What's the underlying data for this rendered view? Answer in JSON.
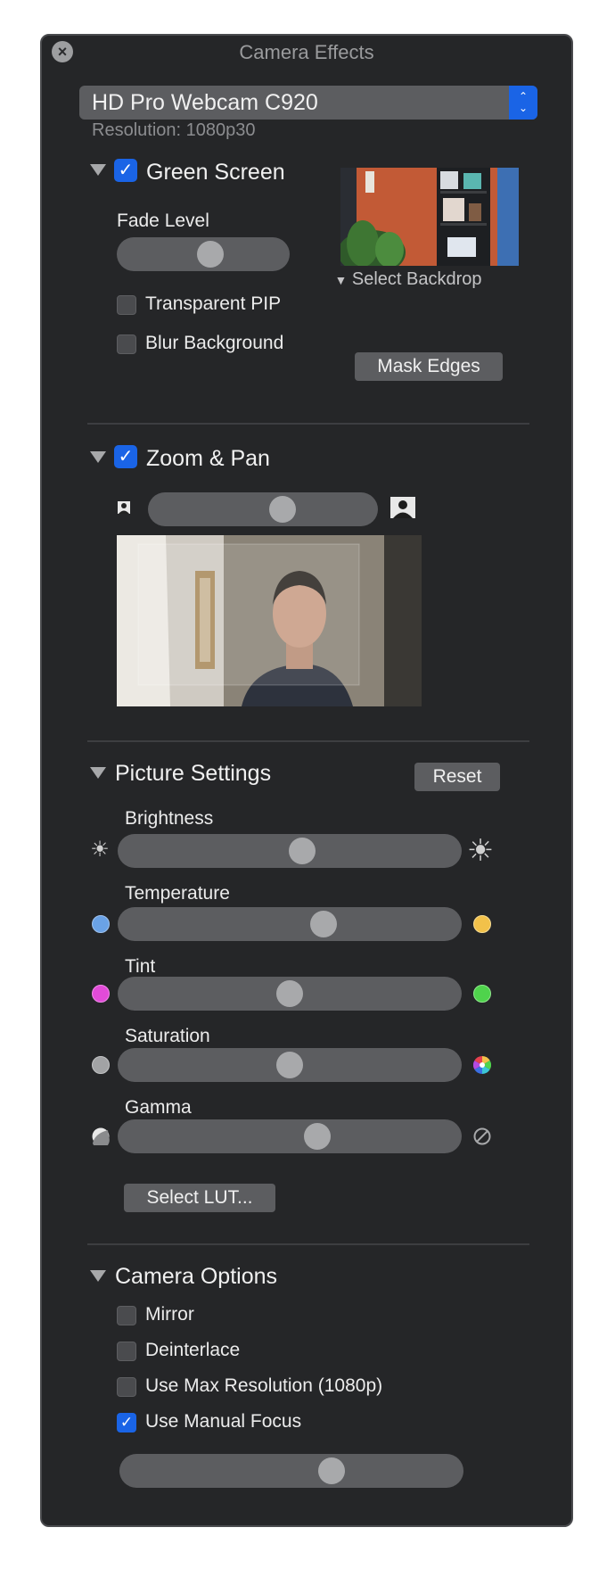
{
  "window": {
    "title": "Camera Effects"
  },
  "camera": {
    "name": "HD Pro Webcam C920",
    "resolution": "Resolution: 1080p30"
  },
  "green_screen": {
    "title": "Green Screen",
    "checked": true,
    "fade_level_label": "Fade Level",
    "fade_level": 0.55,
    "transparent_pip_label": "Transparent PIP",
    "blur_background_label": "Blur Background",
    "select_backdrop_label": "Select Backdrop",
    "mask_edges_label": "Mask Edges"
  },
  "zoom_pan": {
    "title": "Zoom & Pan",
    "checked": true,
    "zoom_level": 0.6
  },
  "picture_settings": {
    "title": "Picture Settings",
    "reset_label": "Reset",
    "sliders": [
      {
        "label": "Brightness",
        "value": 0.54
      },
      {
        "label": "Temperature",
        "value": 0.61
      },
      {
        "label": "Tint",
        "value": 0.5
      },
      {
        "label": "Saturation",
        "value": 0.5
      },
      {
        "label": "Gamma",
        "value": 0.59
      }
    ],
    "select_lut_label": "Select LUT..."
  },
  "camera_options": {
    "title": "Camera Options",
    "options": [
      {
        "label": "Mirror",
        "checked": false
      },
      {
        "label": "Deinterlace",
        "checked": false
      },
      {
        "label": "Use Max Resolution (1080p)",
        "checked": false
      },
      {
        "label": "Use Manual Focus",
        "checked": true
      }
    ],
    "focus_level": 0.63
  },
  "colors": {
    "accent": "#1a64e6",
    "temperature_cool": "#6aa2e6",
    "temperature_warm": "#f2c14a",
    "tint_magenta": "#e24bd8",
    "tint_green": "#4fd34c"
  },
  "icons": {
    "close": "close-icon",
    "person_small": "person-small-icon",
    "person_large": "person-large-icon",
    "brightness_low": "sun-small-icon",
    "brightness_high": "sun-large-icon",
    "saturation_low": "gray-circle-icon",
    "saturation_high": "color-wheel-icon",
    "gamma_low": "gamma-low-icon",
    "gamma_high": "gamma-high-icon"
  }
}
